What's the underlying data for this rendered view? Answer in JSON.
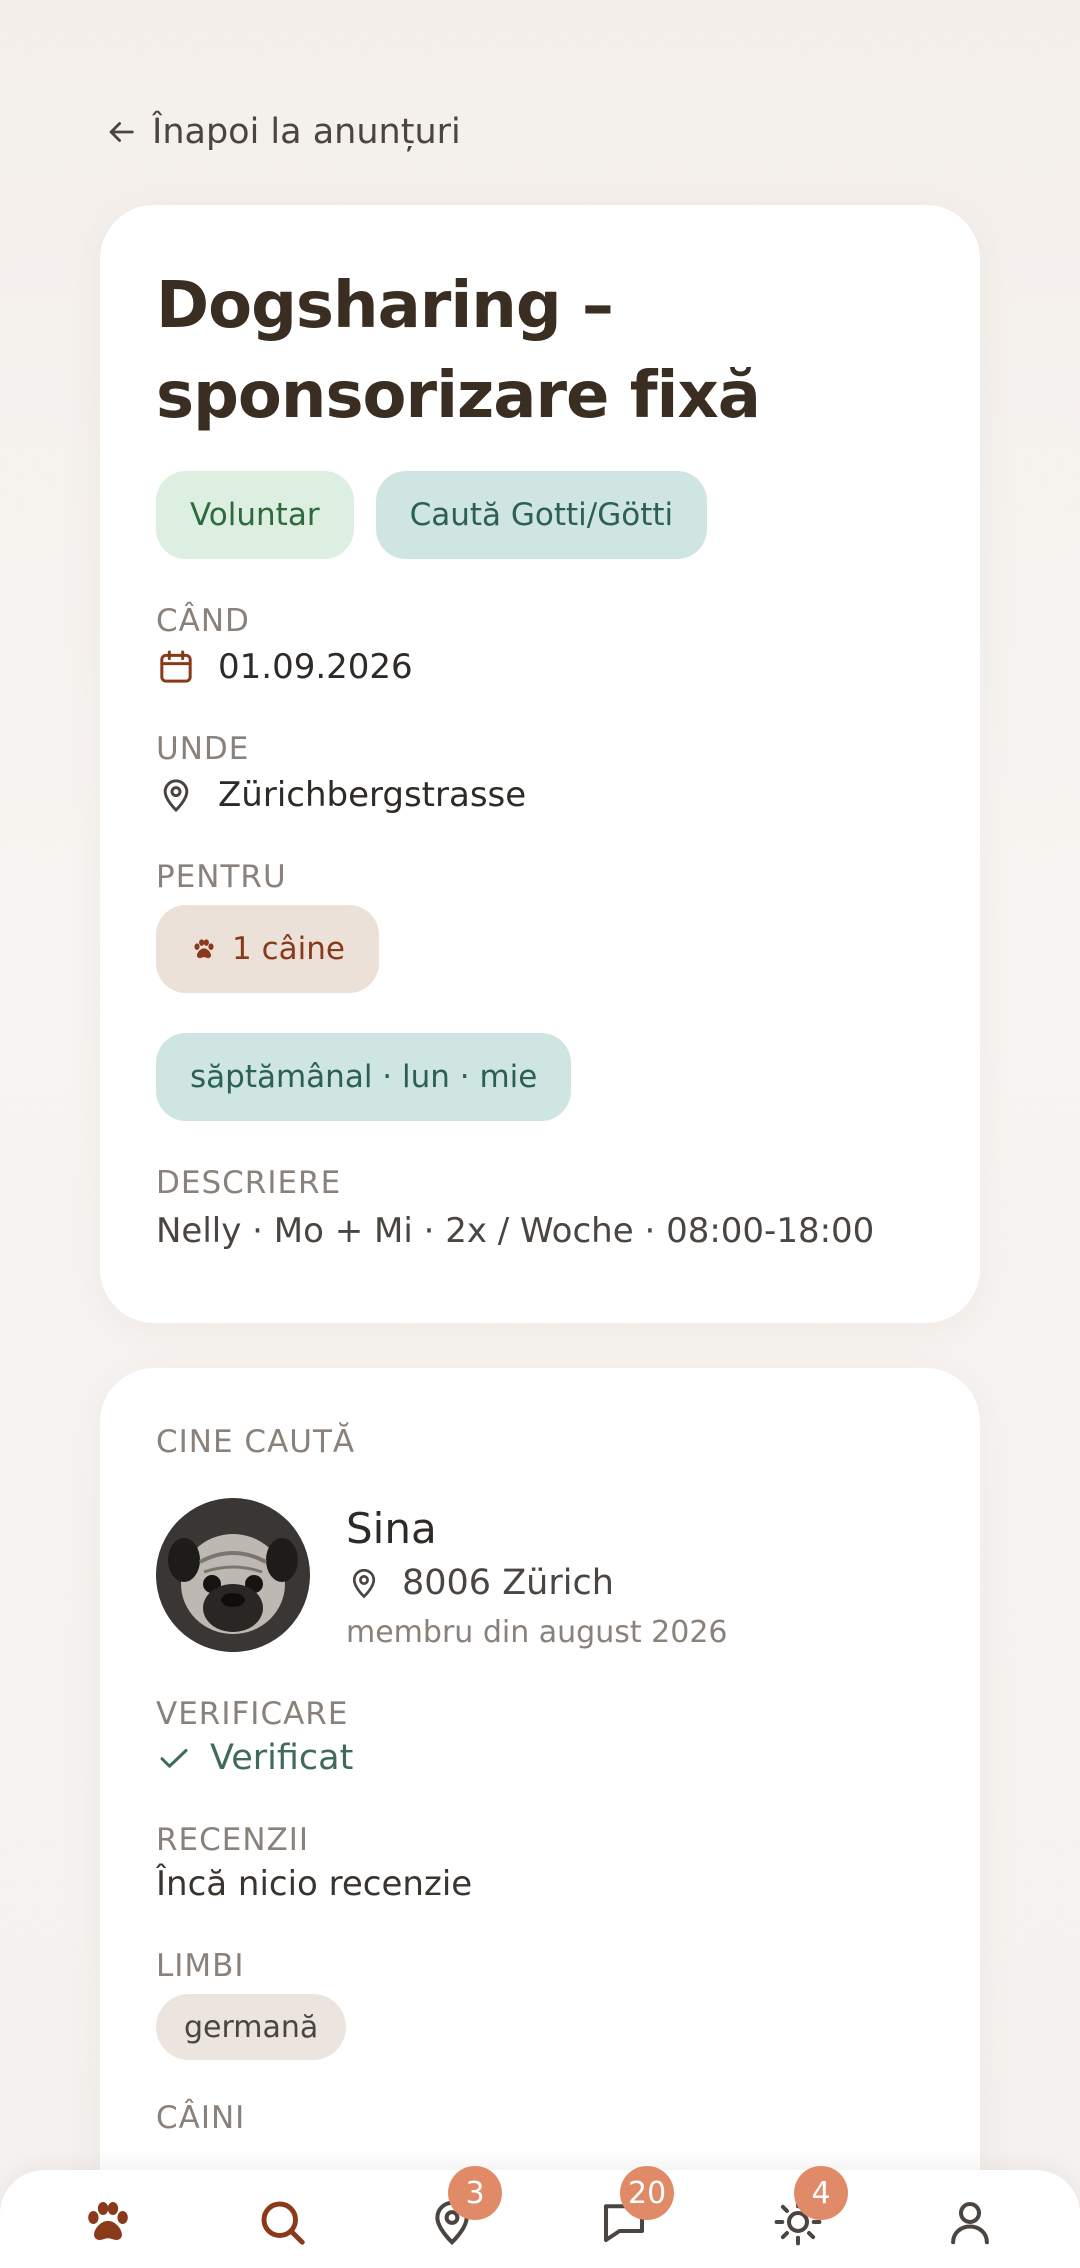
{
  "nav": {
    "back_label": "Înapoi la anunțuri"
  },
  "listing": {
    "title": "Dogsharing – sponsorizare fixă",
    "tags": [
      "Voluntar",
      "Caută Gotti/Götti"
    ],
    "when_label": "CÂND",
    "when_value": "01.09.2026",
    "where_label": "UNDE",
    "where_value": "Zürichbergstrasse",
    "for_label": "PENTRU",
    "for_value": "1 câine",
    "schedule": "săptămânal · lun · mie",
    "description_label": "DESCRIERE",
    "description_value": "Nelly · Mo + Mi · 2x / Woche · 08:00-18:00"
  },
  "seeker": {
    "section_label": "CINE CAUTĂ",
    "name": "Sina",
    "location": "8006 Zürich",
    "member_since": "membru din august 2026",
    "verification_label": "VERIFICARE",
    "verification_value": "Verificat",
    "reviews_label": "RECENZII",
    "reviews_value": "Încă nicio recenzie",
    "languages_label": "LIMBI",
    "languages": [
      "germană"
    ],
    "dogs_label": "CÂINI"
  },
  "tabbar": {
    "items": [
      {
        "icon": "paw-icon",
        "badge": ""
      },
      {
        "icon": "search-icon",
        "badge": ""
      },
      {
        "icon": "map-pin-icon",
        "badge": "3"
      },
      {
        "icon": "chat-icon",
        "badge": "20"
      },
      {
        "icon": "sun-icon",
        "badge": "4"
      },
      {
        "icon": "profile-icon",
        "badge": ""
      }
    ]
  },
  "colors": {
    "accent": "#e08a68",
    "active_tab": "#8a3a1a",
    "tag_green_bg": "#dcefe0",
    "tag_teal_bg": "#cfe5e2",
    "tag_sand_bg": "#ebe1d8"
  }
}
